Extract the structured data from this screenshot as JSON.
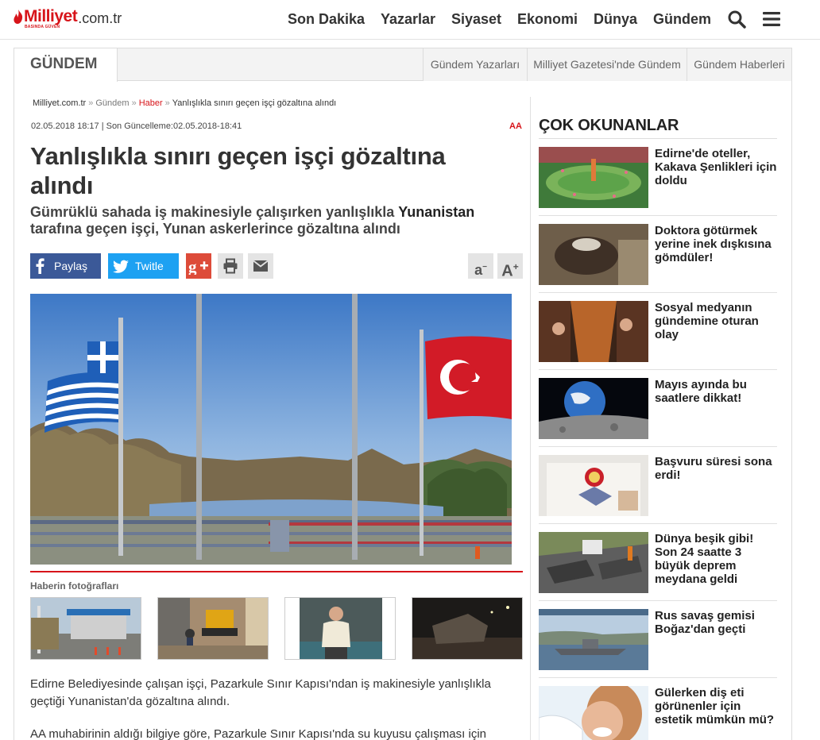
{
  "brand": {
    "name": "Milliyet",
    "tld": ".com.tr",
    "tagline": "BASINDA GÜVEN"
  },
  "nav": {
    "items": [
      "Son Dakika",
      "Yazarlar",
      "Siyaset",
      "Ekonomi",
      "Dünya",
      "Gündem"
    ],
    "search_icon": "search-icon",
    "menu_icon": "hamburger-menu-icon"
  },
  "section": {
    "title": "GÜNDEM",
    "links": [
      "Gündem Yazarları",
      "Milliyet Gazetesi'nde Gündem",
      "Gündem Haberleri"
    ]
  },
  "breadcrumb": {
    "items": [
      "Milliyet.com.tr",
      "Gündem",
      "Haber",
      "Yanlışlıkla sınırı geçen işçi gözaltına alındı"
    ],
    "separator": "»"
  },
  "article": {
    "dates": "02.05.2018 18:17 | Son Güncelleme:02.05.2018-18:41",
    "source": "AA",
    "title": "Yanlışlıkla sınırı geçen işçi gözaltına alındı",
    "spot_before": "Gümrüklü sahada iş makinesiyle çalışırken yanlışlıkla ",
    "spot_bold": "Yunanistan",
    "spot_after": " tarafına geçen işçi, Yunan  askerlerince gözaltına alındı",
    "share_facebook": "Paylaş",
    "share_twitter": "Twitle",
    "font_smaller": "a",
    "font_larger": "A",
    "photos_title": "Haberin fotoğrafları",
    "paragraph_1": "Edirne Belediyesinde çalışan işçi, Pazarkule Sınır  Kapısı'ndan iş makinesiyle yanlışlıkla geçtiği Yunanistan'da gözaltına alındı.",
    "paragraph_2": "AA muhabirinin aldığı bilgiye göre, Pazarkule Sınır Kapısı'nda su kuyusu çalışması için"
  },
  "sidebar": {
    "title": "ÇOK OKUNANLAR",
    "items": [
      "Edirne'de oteller, Kakava Şenlikleri için doldu",
      "Doktora götürmek yerine inek dışkısına gömdüler!",
      "Sosyal medyanın gündemine oturan olay",
      "Mayıs ayında bu saatlere dikkat!",
      "Başvuru süresi sona erdi!",
      "Dünya beşik gibi! Son 24 saatte 3 büyük deprem meydana geldi",
      "Rus savaş gemisi Boğaz'dan geçti",
      "Gülerken diş eti görünenler için estetik mümkün mü?"
    ]
  },
  "colors": {
    "brand_red": "#d7141a",
    "facebook": "#3b5998",
    "twitter": "#1da1f2",
    "google": "#dd4b39"
  }
}
